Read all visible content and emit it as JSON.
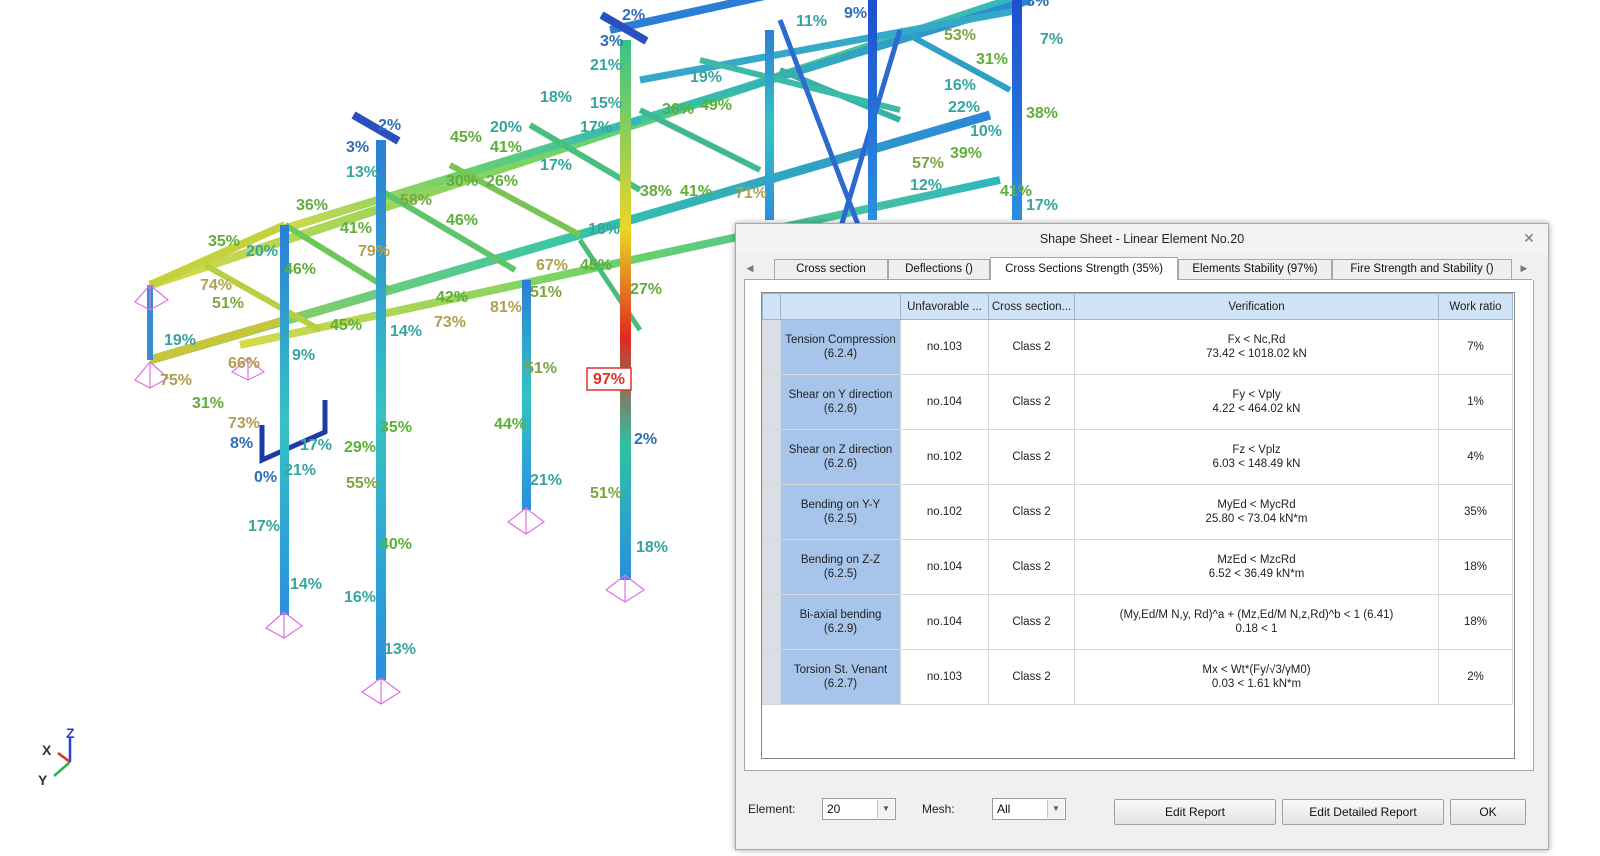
{
  "model": {
    "highlight_label": "97%",
    "percent_labels": [
      {
        "t": "2%",
        "c": "#2f6fb8"
      },
      {
        "t": "3%",
        "c": "#2f6fb8"
      },
      {
        "t": "21%",
        "c": "#35a5a0"
      },
      {
        "t": "18%",
        "c": "#35a5a0"
      },
      {
        "t": "19%",
        "c": "#35a5a0"
      },
      {
        "t": "45%",
        "c": "#5fae3a"
      },
      {
        "t": "20%",
        "c": "#35a5a0"
      },
      {
        "t": "15%",
        "c": "#35a5a0"
      },
      {
        "t": "36%",
        "c": "#5fae3a"
      },
      {
        "t": "49%",
        "c": "#5fae3a"
      },
      {
        "t": "17%",
        "c": "#35a5a0"
      },
      {
        "t": "41%",
        "c": "#5fae3a"
      },
      {
        "t": "17%",
        "c": "#35a5a0"
      },
      {
        "t": "2%",
        "c": "#2f6fb8"
      },
      {
        "t": "3%",
        "c": "#2f6fb8"
      },
      {
        "t": "13%",
        "c": "#35a5a0"
      },
      {
        "t": "30%",
        "c": "#5fae3a"
      },
      {
        "t": "26%",
        "c": "#5fae3a"
      },
      {
        "t": "38%",
        "c": "#5fae3a"
      },
      {
        "t": "41%",
        "c": "#5fae3a"
      },
      {
        "t": "71%",
        "c": "#b0a050"
      },
      {
        "t": "36%",
        "c": "#5fae3a"
      },
      {
        "t": "58%",
        "c": "#7aa640"
      },
      {
        "t": "46%",
        "c": "#5fae3a"
      },
      {
        "t": "18%",
        "c": "#35a5a0"
      },
      {
        "t": "35%",
        "c": "#5fae3a"
      },
      {
        "t": "20%",
        "c": "#35a5a0"
      },
      {
        "t": "41%",
        "c": "#5fae3a"
      },
      {
        "t": "79%",
        "c": "#b0a050"
      },
      {
        "t": "74%",
        "c": "#b0a050"
      },
      {
        "t": "51%",
        "c": "#7aa640"
      },
      {
        "t": "46%",
        "c": "#5fae3a"
      },
      {
        "t": "42%",
        "c": "#5fae3a"
      },
      {
        "t": "73%",
        "c": "#b0a050"
      },
      {
        "t": "81%",
        "c": "#b0a050"
      },
      {
        "t": "67%",
        "c": "#b0a050"
      },
      {
        "t": "45%",
        "c": "#5fae3a"
      },
      {
        "t": "27%",
        "c": "#5fae3a"
      },
      {
        "t": "19%",
        "c": "#35a5a0"
      },
      {
        "t": "66%",
        "c": "#b0a050"
      },
      {
        "t": "75%",
        "c": "#b0a050"
      },
      {
        "t": "9%",
        "c": "#35a5a0"
      },
      {
        "t": "45%",
        "c": "#5fae3a"
      },
      {
        "t": "14%",
        "c": "#35a5a0"
      },
      {
        "t": "51%",
        "c": "#7aa640"
      },
      {
        "t": "51%",
        "c": "#7aa640"
      },
      {
        "t": "31%",
        "c": "#5fae3a"
      },
      {
        "t": "73%",
        "c": "#b0a050"
      },
      {
        "t": "8%",
        "c": "#2f6fb8"
      },
      {
        "t": "0%",
        "c": "#2f6fb8"
      },
      {
        "t": "21%",
        "c": "#35a5a0"
      },
      {
        "t": "17%",
        "c": "#35a5a0"
      },
      {
        "t": "29%",
        "c": "#5fae3a"
      },
      {
        "t": "35%",
        "c": "#5fae3a"
      },
      {
        "t": "55%",
        "c": "#7aa640"
      },
      {
        "t": "44%",
        "c": "#5fae3a"
      },
      {
        "t": "2%",
        "c": "#2f6fb8"
      },
      {
        "t": "21%",
        "c": "#35a5a0"
      },
      {
        "t": "51%",
        "c": "#7aa640"
      },
      {
        "t": "17%",
        "c": "#35a5a0"
      },
      {
        "t": "40%",
        "c": "#5fae3a"
      },
      {
        "t": "14%",
        "c": "#35a5a0"
      },
      {
        "t": "16%",
        "c": "#35a5a0"
      },
      {
        "t": "13%",
        "c": "#35a5a0"
      },
      {
        "t": "18%",
        "c": "#35a5a0"
      },
      {
        "t": "11%",
        "c": "#35a5a0"
      },
      {
        "t": "9%",
        "c": "#2f6fb8"
      },
      {
        "t": "53%",
        "c": "#7aa640"
      },
      {
        "t": "31%",
        "c": "#5fae3a"
      },
      {
        "t": "16%",
        "c": "#35a5a0"
      },
      {
        "t": "22%",
        "c": "#35a5a0"
      },
      {
        "t": "10%",
        "c": "#35a5a0"
      },
      {
        "t": "39%",
        "c": "#5fae3a"
      },
      {
        "t": "57%",
        "c": "#7aa640"
      },
      {
        "t": "12%",
        "c": "#35a5a0"
      },
      {
        "t": "41%",
        "c": "#5fae3a"
      },
      {
        "t": "17%",
        "c": "#35a5a0"
      },
      {
        "t": "38%",
        "c": "#5fae3a"
      },
      {
        "t": "7%",
        "c": "#35a5a0"
      },
      {
        "t": "8%",
        "c": "#2f6fb8"
      }
    ]
  },
  "axes": {
    "x": "X",
    "y": "Y",
    "z": "Z"
  },
  "dialog": {
    "title": "Shape Sheet - Linear Element No.20",
    "tabs": [
      "Cross section",
      "Deflections ()",
      "Cross Sections Strength (35%)",
      "Elements Stability (97%)",
      "Fire Strength and Stability ()"
    ],
    "active_tab": 2,
    "columns": [
      "",
      "Unfavorable ...",
      "Cross section...",
      "Verification",
      "Work ratio"
    ],
    "rows": [
      {
        "check": [
          "Tension Compression",
          "(6.2.4)"
        ],
        "unfavorable": "no.103",
        "section": "Class 2",
        "verification": [
          "Fx < Nc,Rd",
          "73.42 < 1018.02 kN"
        ],
        "ratio": "7%"
      },
      {
        "check": [
          "Shear on Y direction",
          "(6.2.6)"
        ],
        "unfavorable": "no.104",
        "section": "Class 2",
        "verification": [
          "Fy < Vply",
          "4.22 < 464.02 kN"
        ],
        "ratio": "1%"
      },
      {
        "check": [
          "Shear on Z direction",
          "(6.2.6)"
        ],
        "unfavorable": "no.102",
        "section": "Class 2",
        "verification": [
          "Fz < Vplz",
          "6.03 < 148.49 kN"
        ],
        "ratio": "4%"
      },
      {
        "check": [
          "Bending on Y-Y",
          "(6.2.5)"
        ],
        "unfavorable": "no.102",
        "section": "Class 2",
        "verification": [
          "MyEd < MycRd",
          "25.80 < 73.04 kN*m"
        ],
        "ratio": "35%"
      },
      {
        "check": [
          "Bending on Z-Z",
          "(6.2.5)"
        ],
        "unfavorable": "no.104",
        "section": "Class 2",
        "verification": [
          "MzEd < MzcRd",
          "6.52 < 36.49 kN*m"
        ],
        "ratio": "18%"
      },
      {
        "check": [
          "Bi-axial bending",
          "(6.2.9)"
        ],
        "unfavorable": "no.104",
        "section": "Class 2",
        "verification": [
          "(My,Ed/M N,y, Rd)^a + (Mz,Ed/M N,z,Rd)^b < 1 (6.41)",
          "0.18 < 1"
        ],
        "ratio": "18%"
      },
      {
        "check": [
          "Torsion St. Venant",
          "(6.2.7)"
        ],
        "unfavorable": "no.103",
        "section": "Class 2",
        "verification": [
          "Mx < Wt*(Fy/√3/γM0)",
          "0.03 < 1.61 kN*m"
        ],
        "ratio": "2%"
      }
    ],
    "element_label": "Element:",
    "element_value": "20",
    "mesh_label": "Mesh:",
    "mesh_value": "All",
    "buttons": {
      "edit_report": "Edit Report",
      "edit_detailed_report": "Edit Detailed Report",
      "ok": "OK"
    }
  },
  "colors": {
    "high_utilization": "#e0302a",
    "structure_low": "#1f4fc8",
    "structure_mid": "#2fbfa0",
    "structure_high": "#e8e020"
  }
}
